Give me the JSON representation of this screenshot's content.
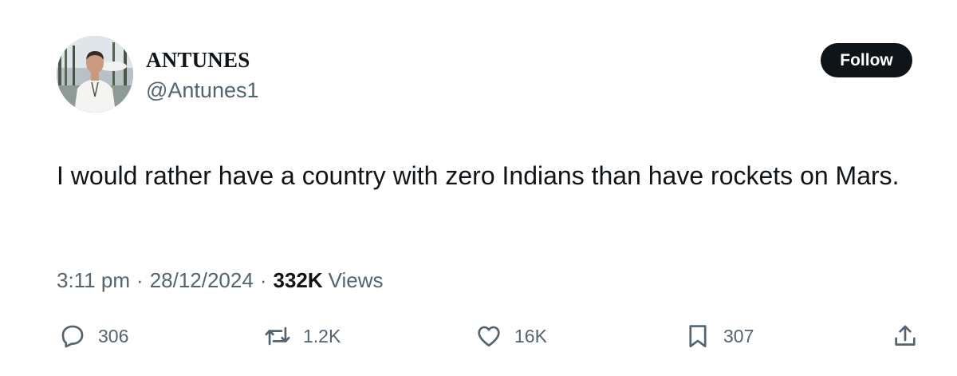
{
  "author": {
    "display_name": "ANTUNES",
    "handle": "@Antunes1"
  },
  "follow_button": {
    "label": "Follow"
  },
  "tweet": {
    "text": "I would rather have a country with zero Indians than have rockets on Mars."
  },
  "meta": {
    "time": "3:11 pm",
    "separator": "·",
    "date": "28/12/2024",
    "views_count": "332K",
    "views_label": "Views"
  },
  "actions": {
    "replies": "306",
    "reposts": "1.2K",
    "likes": "16K",
    "bookmarks": "307"
  },
  "icons": [
    "reply-icon",
    "repost-icon",
    "like-icon",
    "bookmark-icon",
    "share-icon"
  ],
  "colors": {
    "text_primary": "#0f1419",
    "text_secondary": "#536471",
    "button_bg": "#0f1419",
    "button_text": "#ffffff"
  }
}
